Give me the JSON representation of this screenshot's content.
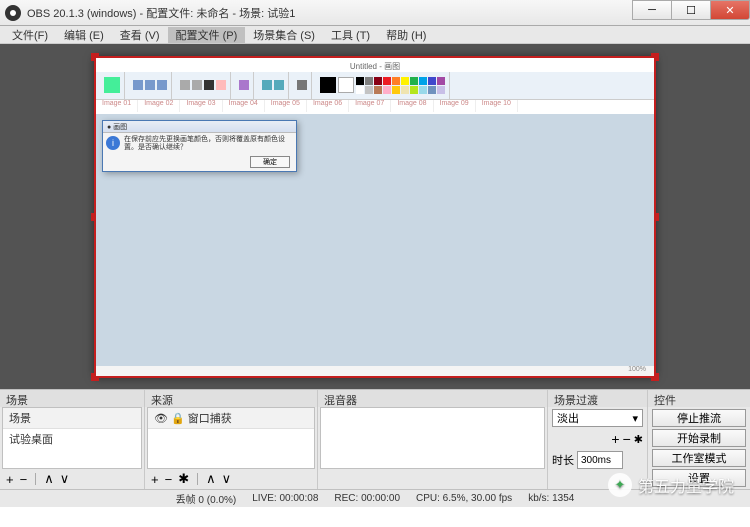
{
  "title": "OBS 20.1.3 (windows) - 配置文件: 未命名 - 场景: 试验1",
  "menu": {
    "file": "文件(F)",
    "edit": "编辑 (E)",
    "view": "查看 (V)",
    "profile": "配置文件 (P)",
    "scene_collection": "场景集合 (S)",
    "tools": "工具 (T)",
    "help": "帮助 (H)"
  },
  "captured": {
    "title": "Untitled - 画图",
    "dialog_title": "● 画图",
    "dialog_text": "在保存前应先更换画笔颜色，否则将覆盖原有颜色设置。是否确认继续？",
    "dialog_btn": "确定",
    "status": "100%"
  },
  "panels": {
    "scenes": {
      "header": "场景",
      "items": [
        "场景",
        "试验桌面"
      ]
    },
    "sources": {
      "header": "来源",
      "items": [
        "窗口捕获"
      ]
    },
    "mixer": {
      "header": "混音器"
    },
    "transitions": {
      "header": "场景过渡",
      "selected": "淡出",
      "duration_label": "时长",
      "duration_value": "300ms"
    },
    "controls": {
      "header": "控件",
      "stop_stream": "停止推流",
      "start_record": "开始录制",
      "studio_mode": "工作室模式",
      "settings_btn": "设置"
    }
  },
  "status": {
    "dropped": "丢帧 0 (0.0%)",
    "live": "LIVE: 00:00:08",
    "rec": "REC: 00:00:00",
    "cpu": "CPU: 6.5%, 30.00 fps",
    "kbps": "kb/s: 1354"
  },
  "footer_icons": {
    "plus": "+",
    "minus": "−",
    "up": "∧",
    "down": "∨",
    "gear": "✱"
  },
  "palette": [
    "#000",
    "#7f7f7f",
    "#880015",
    "#ed1c24",
    "#ff7f27",
    "#fff200",
    "#22b14c",
    "#00a2e8",
    "#3f48cc",
    "#a349a4",
    "#fff",
    "#c3c3c3",
    "#b97a57",
    "#ffaec9",
    "#ffc90e",
    "#efe4b0",
    "#b5e61d",
    "#99d9ea",
    "#7092be",
    "#c8bfe7"
  ],
  "watermark": "第五力量学院"
}
